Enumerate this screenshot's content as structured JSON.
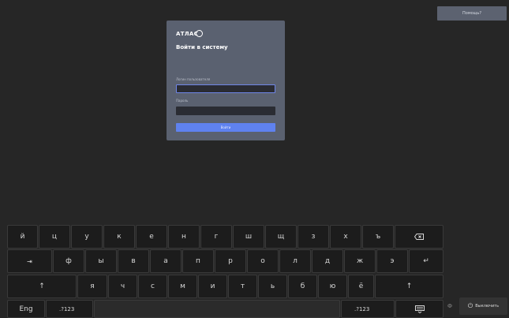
{
  "header": {
    "help_label": "Помощь?"
  },
  "login": {
    "logo_text": "АТЛАС",
    "title": "Войти в систему",
    "username_label": "Логин пользователя",
    "username_value": "",
    "password_label": "Пароль",
    "password_value": "",
    "submit_label": "Войти"
  },
  "keyboard": {
    "row1": [
      "й",
      "ц",
      "у",
      "к",
      "е",
      "н",
      "г",
      "ш",
      "щ",
      "з",
      "х",
      "ъ"
    ],
    "row1_backspace_icon": "backspace-icon",
    "row2_tab": "⇥",
    "row2": [
      "ф",
      "ы",
      "в",
      "а",
      "п",
      "р",
      "о",
      "л",
      "д",
      "ж",
      "э"
    ],
    "row2_enter": "↵",
    "row3_shift": "↑",
    "row3": [
      "я",
      "ч",
      "с",
      "м",
      "и",
      "т",
      "ь",
      "б",
      "ю",
      "ё"
    ],
    "row3_shift_right": "↑",
    "lang_label": "Eng",
    "symbols_left": ".?123",
    "symbols_right": ".?123",
    "hide_icon": "keyboard-hide-icon"
  },
  "footer": {
    "power_glyph": "Ф",
    "shutdown_label": "Выключить",
    "shutdown_icon": "power-icon"
  }
}
